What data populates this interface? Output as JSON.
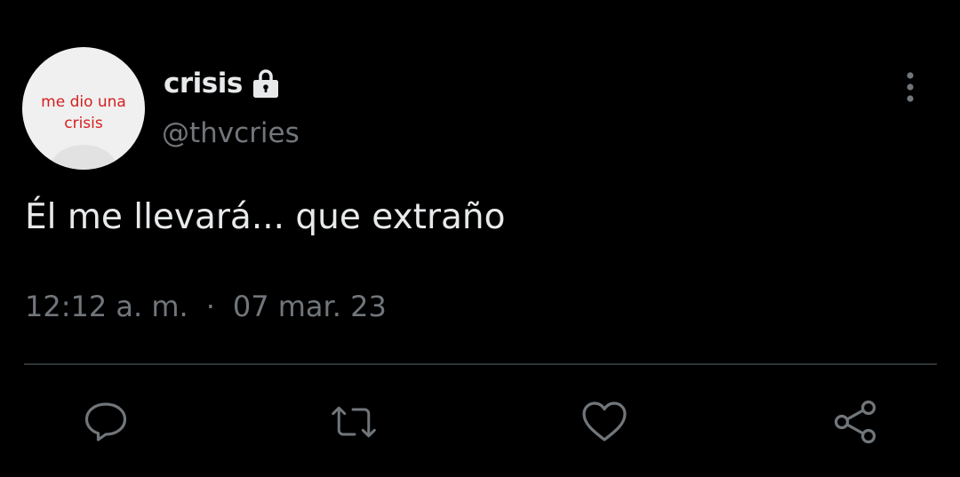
{
  "avatar": {
    "line1": "me dio una",
    "line2": "crisis"
  },
  "user": {
    "display_name": "crisis",
    "handle": "@thvcries",
    "protected_icon": "lock-icon"
  },
  "tweet": {
    "text": "Él me llevará... que extraño",
    "time": "12:12 a. m.",
    "separator": "·",
    "date": "07 mar. 23"
  },
  "actions": {
    "icons": [
      "reply-icon",
      "retweet-icon",
      "like-icon",
      "share-icon"
    ]
  },
  "colors": {
    "background": "#000000",
    "text": "#e7e9ea",
    "secondary": "#71767b",
    "divider": "#2f3336",
    "avatar_text": "#d42020"
  }
}
